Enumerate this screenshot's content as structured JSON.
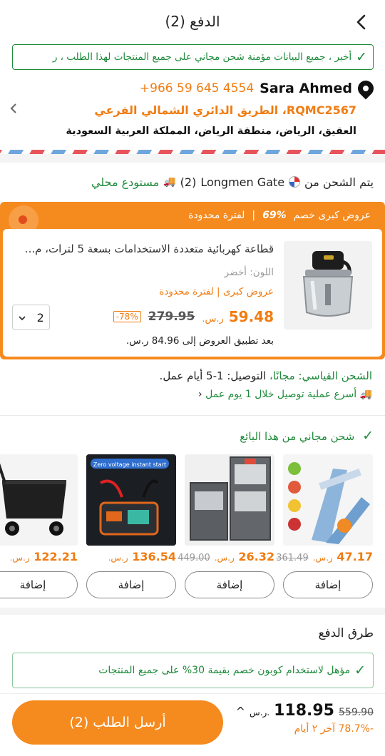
{
  "header": {
    "title": "الدفع (2)",
    "back_icon": "chevron-left-icon"
  },
  "banner": {
    "text": "أخير ، جميع البيانات مؤمنة    شحن مجاني على جميع المنتجات لهذا الطلب ، ر"
  },
  "address": {
    "name": "Sara Ahmed",
    "phone": "+966 59 645 4554",
    "line1": "RQMC2567، الطريق الدائري الشمالي الفرعي",
    "line2": "العقيق، الرياض، منطقة الرياض، المملكة العربية السعودية"
  },
  "shipping_origin": {
    "prefix": "يتم الشحن من",
    "store": "Longmen Gate",
    "count": "(2)",
    "warehouse": "مستودع محلي"
  },
  "deal": {
    "title": "عروض كبرى خصم",
    "percent": "69%",
    "limited": "لفترة محدودة"
  },
  "product": {
    "title": "قطاعة كهربائية متعددة الاستخدامات بسعة 5 لترات، م...",
    "color": "اللون: أخضر",
    "badge": "عروض كبرى | لفترة محدودة",
    "price": "59.48",
    "currency": "ر.س.",
    "old_price": "279.95",
    "discount": "-78%",
    "quantity": "2",
    "after_deal": "بعد تطبيق العروض إلى 84.96 ر.س."
  },
  "shipping_info": {
    "standard_label": "الشحن القياسي: مجانًا،",
    "delivery": "التوصيل: 1-5 أيام عمل.",
    "fast": "أسرع عملية توصيل خلال 1 يوم عمل"
  },
  "seller": {
    "free_shipping": "شحن مجاني من هذا البائع"
  },
  "recommendations": [
    {
      "price": "47.17",
      "old_price": "361.49",
      "currency": "ر.س.",
      "add_label": "إضافة",
      "image": "vegetable-slicer"
    },
    {
      "price": "26.32",
      "old_price": "449.00",
      "currency": "ر.س.",
      "add_label": "إضافة",
      "image": "storage-bags"
    },
    {
      "price": "136.54",
      "old_price": "",
      "currency": "ر.س.",
      "add_label": "إضافة",
      "image": "jump-starter",
      "image_text": "Zero voltage instant start"
    },
    {
      "price": "122.21",
      "old_price": "",
      "currency": "ر.س.",
      "add_label": "إضافة",
      "image": "folding-wagon"
    }
  ],
  "payment": {
    "title": "طرق الدفع",
    "coupon": "مؤهل لاستخدام كوبون خصم بقيمة 30% على جميع المنتجات"
  },
  "bottom": {
    "submit_label": "أرسل الطلب (2)",
    "total_old": "559.90",
    "total": "118.95",
    "currency": "ر.س.",
    "savings": "-78.7%  آخر ٢ أيام"
  },
  "colors": {
    "accent": "#f58a1e",
    "price": "#f07c12",
    "success": "#1e8a3a"
  }
}
